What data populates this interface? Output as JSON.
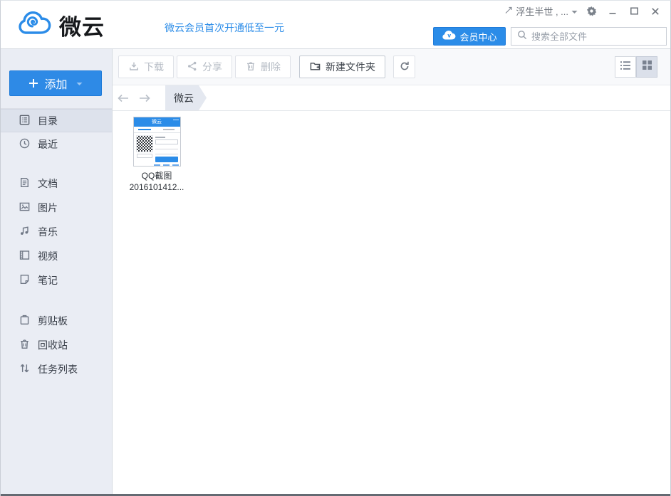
{
  "window": {
    "app_name": "微云"
  },
  "titlebar": {
    "username": "浮生半世 , ...",
    "icons": {
      "user_badge": "pen-badge-icon",
      "dropdown": "caret-down-icon",
      "settings": "gear-icon",
      "minimize": "minimize-icon",
      "maximize": "maximize-icon",
      "close": "close-icon"
    }
  },
  "header": {
    "logo_text": "微云",
    "promo_text": "微云会员首次开通低至一元",
    "member_center_label": "会员中心",
    "member_center_icon": "cloud-v-icon",
    "search_placeholder": "搜索全部文件",
    "search_icon": "search-icon"
  },
  "toolbar": {
    "download_label": "下载",
    "share_label": "分享",
    "delete_label": "删除",
    "new_folder_label": "新建文件夹",
    "refresh_icon": "refresh-icon",
    "view_toggle": {
      "list_icon": "list-view-icon",
      "grid_icon": "grid-view-icon",
      "active_view": "grid"
    }
  },
  "breadcrumb": {
    "root_label": "微云"
  },
  "sidebar": {
    "add_label": "添加",
    "groups": [
      {
        "items": [
          {
            "label": "目录",
            "icon": "directory-icon",
            "selected": true
          },
          {
            "label": "最近",
            "icon": "clock-icon",
            "selected": false
          }
        ]
      },
      {
        "items": [
          {
            "label": "文档",
            "icon": "document-icon"
          },
          {
            "label": "图片",
            "icon": "image-icon"
          },
          {
            "label": "音乐",
            "icon": "music-icon"
          },
          {
            "label": "视频",
            "icon": "video-icon"
          },
          {
            "label": "笔记",
            "icon": "note-icon"
          }
        ]
      },
      {
        "items": [
          {
            "label": "剪贴板",
            "icon": "clipboard-icon"
          },
          {
            "label": "回收站",
            "icon": "trash-icon"
          },
          {
            "label": "任务列表",
            "icon": "task-list-icon"
          }
        ]
      }
    ]
  },
  "files": [
    {
      "name_line1": "QQ截图",
      "name_line2": "2016101412..."
    }
  ],
  "colors": {
    "accent_blue": "#2b8ce8",
    "sidebar_bg": "#eaedf4",
    "selected_item_bg": "#dde2ec",
    "toolbar_bg": "#f8f9fb",
    "disabled_text": "#b6bcc5",
    "breadcrumb_tab_bg": "#e4e8f0",
    "bottom_edge": "#646a72"
  }
}
